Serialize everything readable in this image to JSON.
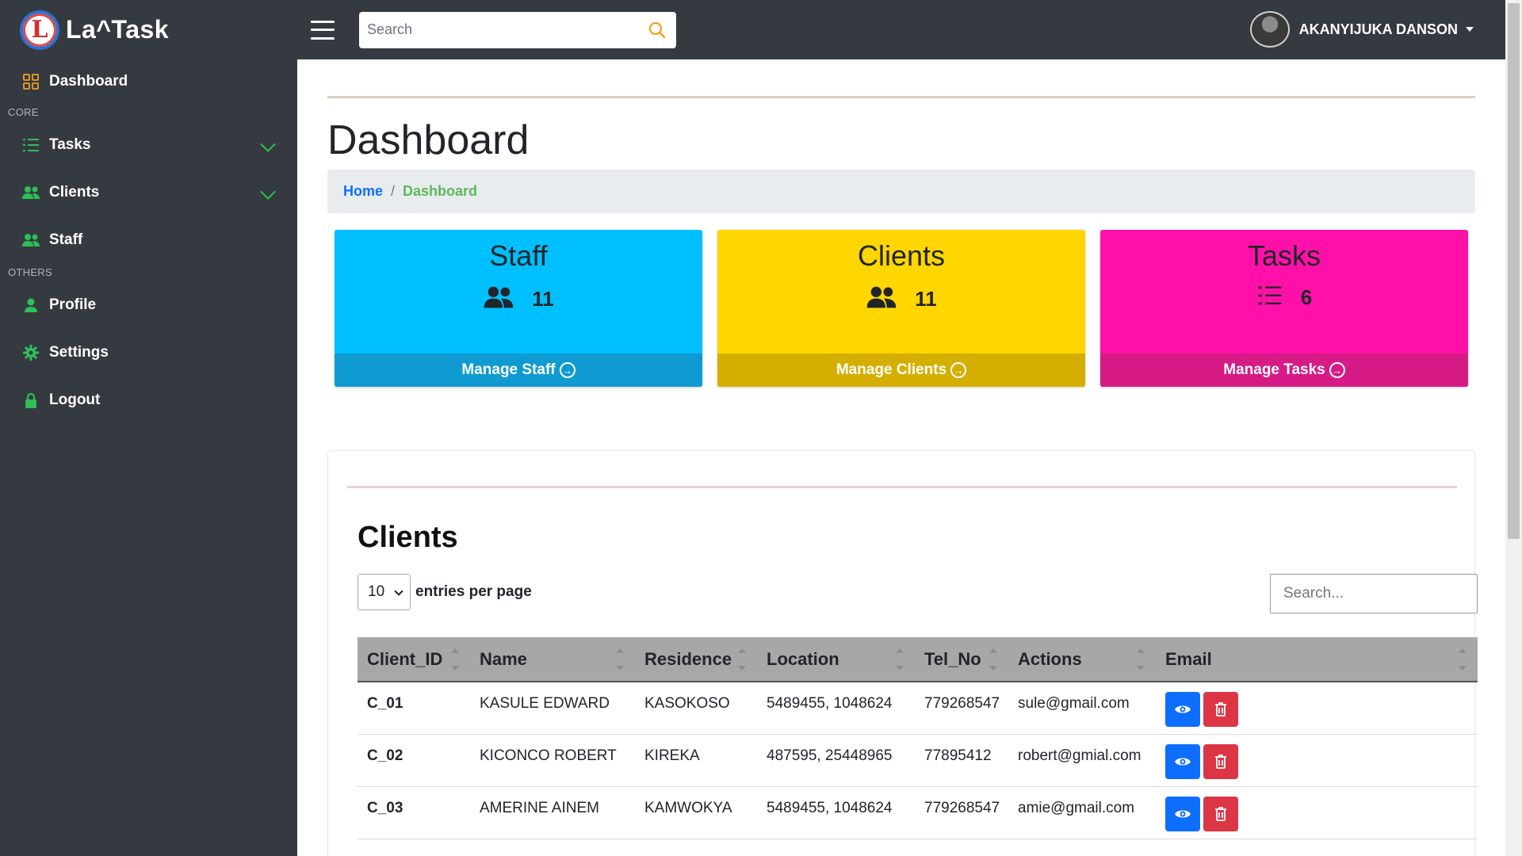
{
  "brand": {
    "logo_letter": "L",
    "name": "La^Task"
  },
  "topbar": {
    "search_placeholder": "Search",
    "user_name": "AKANYIJUKA DANSON"
  },
  "sidebar": {
    "dashboard": "Dashboard",
    "section_core": "CORE",
    "tasks": "Tasks",
    "clients": "Clients",
    "staff": "Staff",
    "section_others": "OTHERS",
    "profile": "Profile",
    "settings": "Settings",
    "logout": "Logout"
  },
  "page": {
    "title": "Dashboard",
    "breadcrumb_home": "Home",
    "breadcrumb_sep": "/",
    "breadcrumb_active": "Dashboard"
  },
  "cards": [
    {
      "title": "Staff",
      "count": "11",
      "footer": "Manage Staff",
      "color": "#00bfff",
      "footer_color": "#0f9bd1"
    },
    {
      "title": "Clients",
      "count": "11",
      "footer": "Manage Clients",
      "color": "#ffd600",
      "footer_color": "#d5af00"
    },
    {
      "title": "Tasks",
      "count": "6",
      "footer": "Manage Tasks",
      "color": "#ff11a9",
      "footer_color": "#d61a86"
    }
  ],
  "clients_table": {
    "title": "Clients",
    "per_page_value": "10",
    "per_page_label": "entries per page",
    "search_placeholder": "Search...",
    "headers": [
      "Client_ID",
      "Name",
      "Residence",
      "Location",
      "Tel_No",
      "Actions",
      "Email"
    ],
    "rows": [
      {
        "id": "C_01",
        "name": "KASULE EDWARD",
        "residence": "KASOKOSO",
        "location": "5489455, 1048624",
        "tel": "779268547",
        "actions": "sule@gmail.com"
      },
      {
        "id": "C_02",
        "name": "KICONCO ROBERT",
        "residence": "KIREKA",
        "location": "487595, 25448965",
        "tel": "77895412",
        "actions": "robert@gmial.com"
      },
      {
        "id": "C_03",
        "name": "AMERINE AINEM",
        "residence": "KAMWOKYA",
        "location": "5489455, 1048624",
        "tel": "779268547",
        "actions": "amie@gmail.com"
      }
    ]
  },
  "colors": {
    "sidebar_bg": "#343a40",
    "accent_green": "#2ebf5a",
    "link_blue": "#0d6efd"
  }
}
